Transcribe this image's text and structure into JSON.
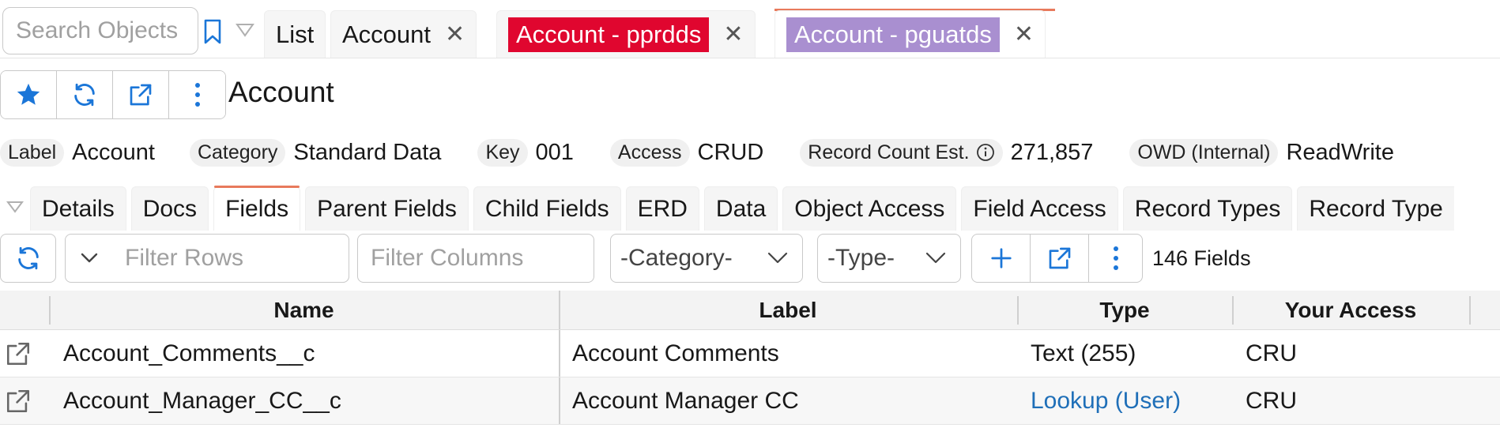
{
  "search": {
    "placeholder": "Search Objects"
  },
  "top_tabs": [
    {
      "label": "List"
    },
    {
      "label": "Account"
    },
    {
      "label": "Account - pprdds",
      "color": "#e0062f"
    },
    {
      "label": "Account - pguatds",
      "color": "#a98fd0"
    }
  ],
  "object": {
    "title": "Account"
  },
  "info": {
    "label_label": "Label",
    "label_value": "Account",
    "category_label": "Category",
    "category_value": "Standard Data",
    "key_label": "Key",
    "key_value": "001",
    "access_label": "Access",
    "access_value": "CRUD",
    "record_count_label": "Record Count Est.",
    "record_count_value": "271,857",
    "owd_label": "OWD (Internal)",
    "owd_value": "ReadWrite"
  },
  "sub_tabs": [
    "Details",
    "Docs",
    "Fields",
    "Parent Fields",
    "Child Fields",
    "ERD",
    "Data",
    "Object Access",
    "Field Access",
    "Record Types",
    "Record Type"
  ],
  "toolbar": {
    "filter_rows_placeholder": "Filter Rows",
    "filter_columns_placeholder": "Filter Columns",
    "category_select": "-Category-",
    "type_select": "-Type-",
    "count_text": "146 Fields"
  },
  "table": {
    "headers": {
      "name": "Name",
      "label": "Label",
      "type": "Type",
      "access": "Your Access"
    },
    "rows": [
      {
        "name": "Account_Comments__c",
        "label": "Account Comments",
        "type": "Text (255)",
        "access": "CRU"
      },
      {
        "name": "Account_Manager_CC__c",
        "label": "Account Manager CC",
        "type": "Lookup (User)",
        "access": "CRU"
      }
    ]
  },
  "colors": {
    "accent": "#1b76d8",
    "active_tab_line": "#e87a5c",
    "link": "#1f6fb8"
  }
}
